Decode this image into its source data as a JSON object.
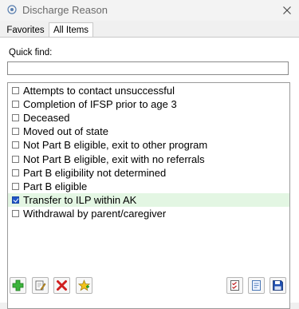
{
  "window": {
    "title": "Discharge Reason"
  },
  "tabs": [
    {
      "label": "Favorites"
    },
    {
      "label": "All Items"
    }
  ],
  "quick_find": {
    "label": "Quick find:",
    "value": "",
    "placeholder": ""
  },
  "items": [
    {
      "label": "Attempts to contact unsuccessful",
      "checked": false
    },
    {
      "label": "Completion of IFSP prior to age 3",
      "checked": false
    },
    {
      "label": "Deceased",
      "checked": false
    },
    {
      "label": "Moved out of state",
      "checked": false
    },
    {
      "label": "Not Part B eligible, exit to other program",
      "checked": false
    },
    {
      "label": "Not Part B eligible, exit with no referrals",
      "checked": false
    },
    {
      "label": "Part B eligibility not determined",
      "checked": false
    },
    {
      "label": "Part B eligible",
      "checked": false
    },
    {
      "label": "Transfer to ILP within AK",
      "checked": true
    },
    {
      "label": "Withdrawal by parent/caregiver",
      "checked": false
    }
  ],
  "toolbar": {
    "left": [
      "add-icon",
      "edit-icon",
      "delete-icon",
      "favorite-icon"
    ],
    "right": [
      "checklist-icon",
      "document-icon",
      "save-icon"
    ]
  },
  "colors": {
    "selected_row": "#e3f6e3",
    "checkbox_checked": "#1f56c7"
  }
}
